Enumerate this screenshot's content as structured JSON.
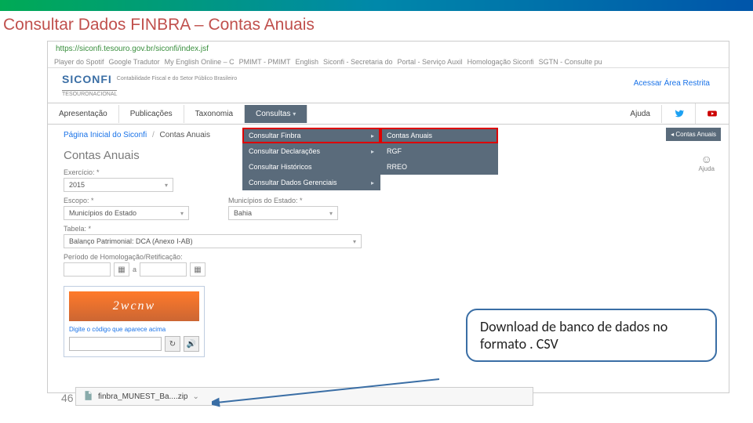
{
  "slide": {
    "title": "Consultar Dados FINBRA – Contas Anuais",
    "page_number": "46"
  },
  "url": "https://siconfi.tesouro.gov.br/siconfi/index.jsf",
  "browser_tabs": [
    "Player do Spotif",
    "Google Tradutor",
    "My English Online – C",
    "PMIMT - PMIMT",
    "English",
    "Siconfi - Secretaria do",
    "Portal - Serviço Auxil",
    "Homologação Siconfi",
    "SGTN - Consulte pu"
  ],
  "brand": {
    "logo": "SICONFI",
    "tagline": "Contabilidade Fiscal e do Setor Público Brasileiro",
    "tesouro": "TESOURONACIONAL",
    "restrita": "Acessar Área Restrita"
  },
  "menu": {
    "items": [
      "Apresentação",
      "Publicações",
      "Taxonomia",
      "Consultas",
      "Ajuda"
    ],
    "caret": "▾"
  },
  "submenu": [
    "Consultar Finbra",
    "Consultar Declarações",
    "Consultar Históricos",
    "Consultar Dados Gerenciais"
  ],
  "flymenu": [
    "Contas Anuais",
    "RGF",
    "RREO"
  ],
  "sidebadge": "Contas Anuais",
  "ajuda": {
    "label": "Ajuda"
  },
  "breadcrumb": {
    "home": "Página Inicial do Siconfi",
    "current": "Contas Anuais"
  },
  "page": {
    "heading": "Contas Anuais"
  },
  "form": {
    "exercicio_label": "Exercício: *",
    "exercicio_value": "2015",
    "escopo_label": "Escopo: *",
    "escopo_value": "Municípios do Estado",
    "muni_label": "Municípios do Estado: *",
    "muni_value": "Bahia",
    "tabela_label": "Tabela: *",
    "tabela_value": "Balanço Patrimonial: DCA (Anexo I-AB)",
    "periodo_label": "Período de Homologação/Retificação:",
    "sep": "a"
  },
  "captcha": {
    "text": "2wcnw",
    "label": "Digite o código que aparece acima"
  },
  "download": {
    "file": "finbra_MUNEST_Ba....zip"
  },
  "callout": {
    "text": "Download de banco de dados no formato . CSV"
  }
}
